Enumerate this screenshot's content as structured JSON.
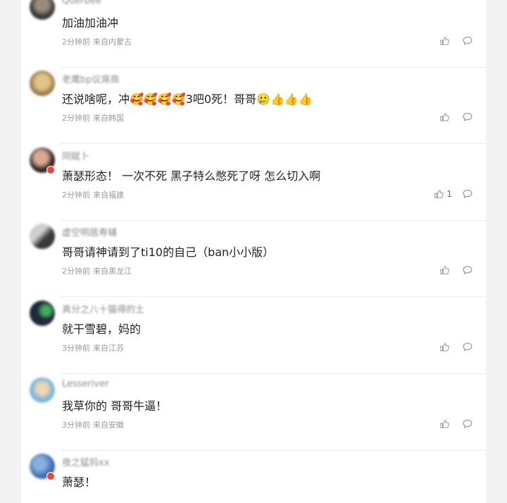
{
  "comments": [
    {
      "username": "Querbee",
      "text": "加油加油冲",
      "time": "2分钟前",
      "location": "来自内蒙古",
      "likes": ""
    },
    {
      "username": "老鹰bp议席商",
      "text": "还说啥呢，冲🥰🥰🥰🥰3吧0死！哥哥🥲👍👍👍",
      "time": "2分钟前",
      "location": "来自韩国",
      "likes": ""
    },
    {
      "username": "同赋卜",
      "text": "萧瑟形态！ 一次不死 黑子特么憋死了呀 怎么切入啊",
      "time": "2分钟前",
      "location": "来自福建",
      "likes": "1"
    },
    {
      "username": "虚空明居寿辅",
      "text": "哥哥请神请到了ti10的自己（ban小小版）",
      "time": "2分钟前",
      "location": "来自黑龙江",
      "likes": ""
    },
    {
      "username": "真分之八十猫得的土",
      "text": "就干雪碧，妈的",
      "time": "3分钟前",
      "location": "来自江苏",
      "likes": ""
    },
    {
      "username": "Lesseriver",
      "text": "我草你的 哥哥牛逼！",
      "time": "3分钟前",
      "location": "来自安徽",
      "likes": ""
    },
    {
      "username": "夜之猛犸xx",
      "text": "萧瑟！",
      "time": "",
      "location": "",
      "likes": ""
    }
  ],
  "avatar_colors": [
    "#4a4a4a",
    "#b89a66",
    "#7a4a3a",
    "#5a5a5a",
    "#2f3f4f",
    "#68a9d8",
    "#4a7cc0"
  ],
  "icons": {
    "like": "thumbs-up-icon",
    "reply": "comment-bubble-icon",
    "badge": "verified-badge-icon"
  }
}
